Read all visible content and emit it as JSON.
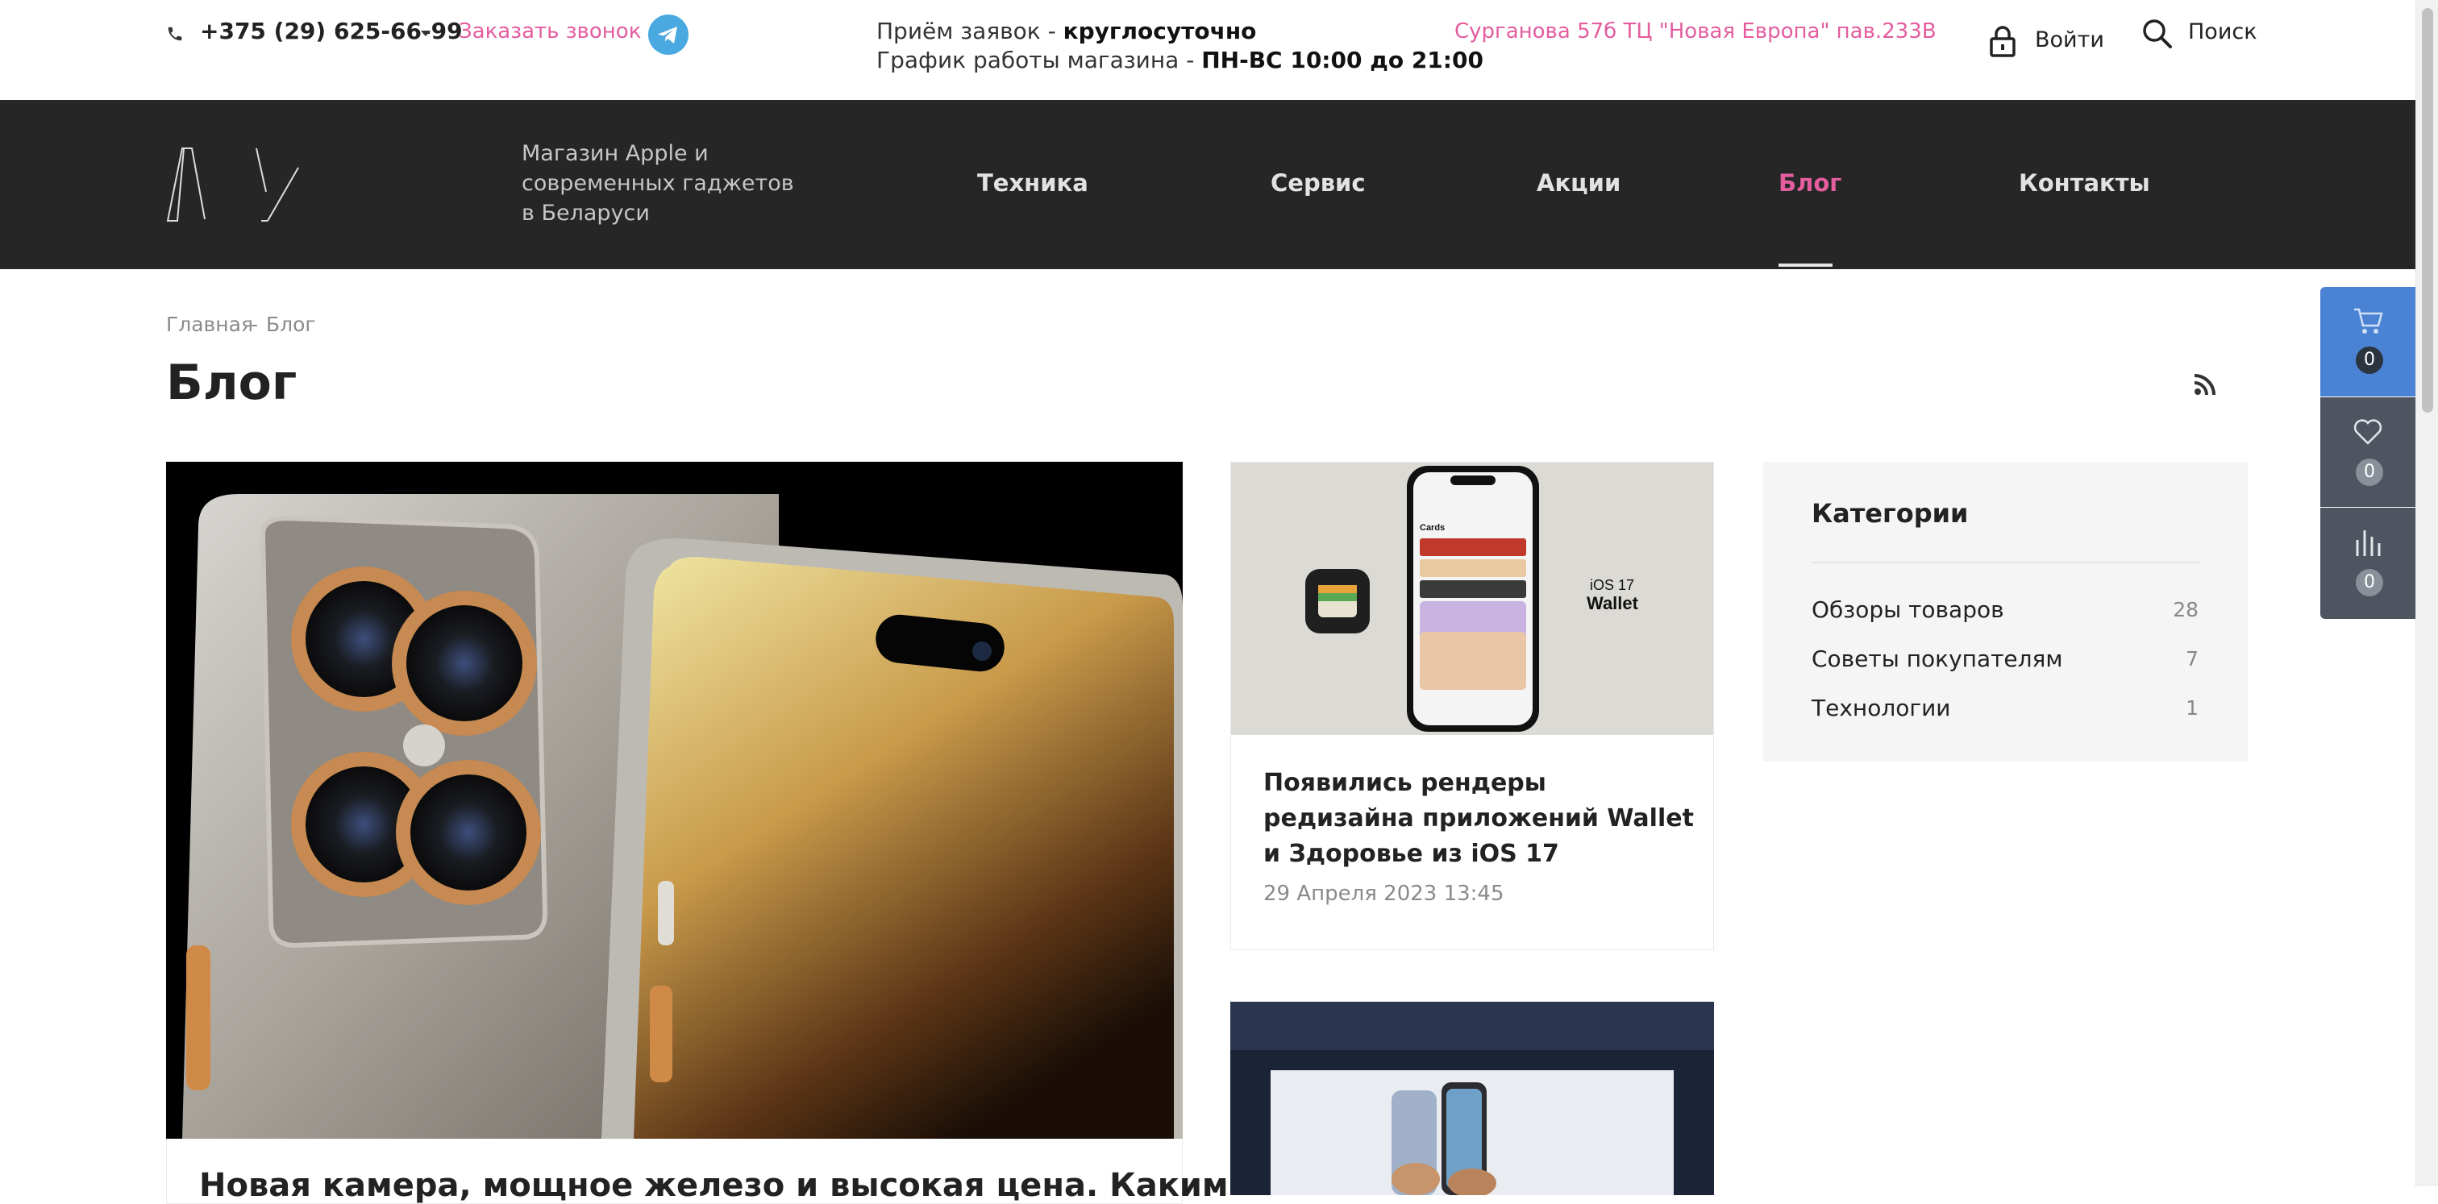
{
  "topbar": {
    "phone": "+375 (29) 625-66-99",
    "callback": "Заказать звонок",
    "hours_line1_prefix": "Приём заявок - ",
    "hours_line1_value": "круглосуточно",
    "hours_line2_prefix": "График работы магазина - ",
    "hours_line2_value": "ПН-ВС 10:00 до 21:00",
    "address": "Сурганова 57б ТЦ \"Новая Европа\" пав.233В",
    "login": "Войти",
    "search": "Поиск"
  },
  "header": {
    "tagline": "Магазин Apple и современных гаджетов в Беларуси",
    "nav": [
      {
        "label": "Техника"
      },
      {
        "label": "Сервис"
      },
      {
        "label": "Акции"
      },
      {
        "label": "Блог",
        "active": true
      },
      {
        "label": "Контакты"
      }
    ]
  },
  "breadcrumb": {
    "home": "Главная",
    "separator": "-",
    "current": "Блог"
  },
  "page": {
    "title": "Блог"
  },
  "sidepanel": {
    "cart_count": "0",
    "favorites_count": "0",
    "compare_count": "0"
  },
  "featured": {
    "title": "Новая камера, мощное железо и высокая цена. Каким"
  },
  "articles": [
    {
      "title": "Появились рендеры редизайна приложений Wallet и Здоровье из iOS 17",
      "date": "29 Апреля 2023 13:45",
      "image_text": {
        "top": "iOS 17",
        "bottom": "Wallet",
        "screen": "Cards"
      }
    }
  ],
  "categories": {
    "title": "Категории",
    "items": [
      {
        "name": "Обзоры товаров",
        "count": "28"
      },
      {
        "name": "Советы покупателям",
        "count": "7"
      },
      {
        "name": "Технологии",
        "count": "1"
      }
    ]
  },
  "colors": {
    "accent": "#e35d9f",
    "nav_bg": "#262626",
    "panel_blue": "#4a82d4",
    "panel_gray": "#4f5560"
  }
}
